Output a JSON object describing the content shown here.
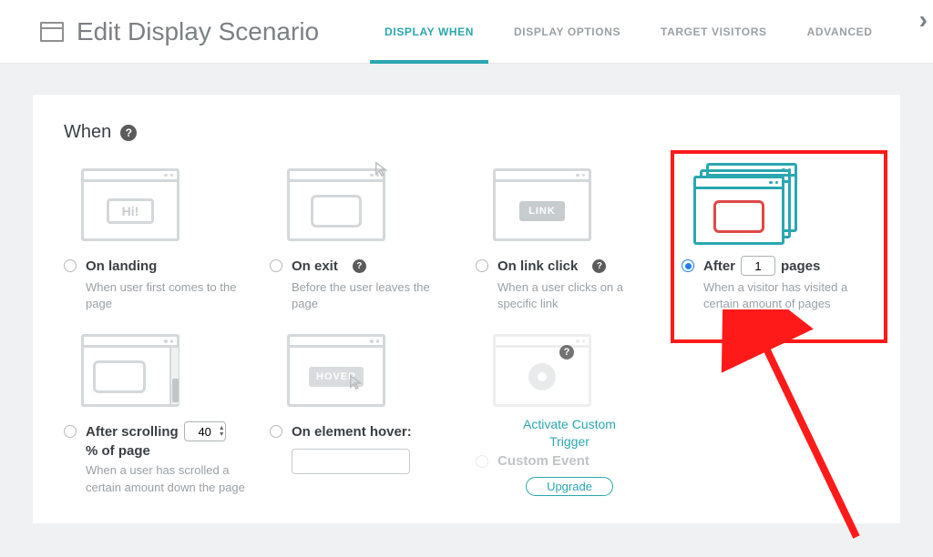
{
  "header": {
    "title": "Edit Display Scenario",
    "tabs": [
      {
        "label": "DISPLAY WHEN",
        "active": true
      },
      {
        "label": "DISPLAY OPTIONS",
        "active": false
      },
      {
        "label": "TARGET VISITORS",
        "active": false
      },
      {
        "label": "ADVANCED",
        "active": false
      }
    ]
  },
  "section_title": "When",
  "options": {
    "landing": {
      "title": "On landing",
      "desc": "When user first comes to the page",
      "hi_text": "Hi!"
    },
    "exit": {
      "title": "On exit",
      "desc": "Before the user leaves the page"
    },
    "link": {
      "title": "On link click",
      "desc": "When a user clicks on a specific link",
      "badge": "LINK"
    },
    "after_pages": {
      "title_before": "After",
      "title_after": "pages",
      "value": "1",
      "desc": "When a visitor has visited a certain amount of pages"
    },
    "scroll": {
      "title_before": "After scrolling",
      "value": "40",
      "title_after": "% of page",
      "desc": "When a user has scrolled a certain amount down the page"
    },
    "hover": {
      "title": "On element hover:",
      "badge": "HOVER"
    },
    "custom": {
      "activate_label1": "Activate Custom",
      "activate_label2": "Trigger",
      "event_label": "Custom Event",
      "upgrade": "Upgrade"
    }
  }
}
